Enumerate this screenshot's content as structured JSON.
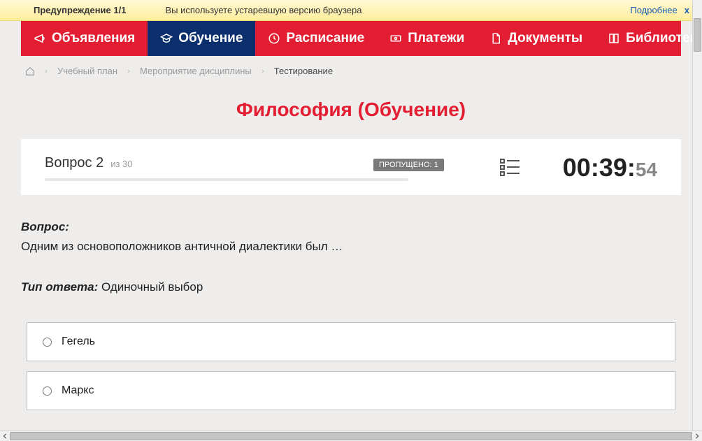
{
  "warning": {
    "title": "Предупреждение 1/1",
    "message": "Вы используете устаревшую версию браузера",
    "more": "Подробнее",
    "close": "x"
  },
  "nav": {
    "items": [
      {
        "label": "Объявления"
      },
      {
        "label": "Обучение"
      },
      {
        "label": "Расписание"
      },
      {
        "label": "Платежи"
      },
      {
        "label": "Документы"
      },
      {
        "label": "Библиотека"
      }
    ]
  },
  "breadcrumb": {
    "items": [
      "Учебный план",
      "Мероприятие дисциплины",
      "Тестирование"
    ]
  },
  "page_title": "Философия (Обучение)",
  "card": {
    "question_label": "Вопрос 2",
    "total_label": "из 30",
    "skipped": "ПРОПУЩЕНО: 1",
    "timer_main": "00:39:",
    "timer_sec": "54"
  },
  "question": {
    "heading": "Вопрос:",
    "text": "Одним из основоположников античной диалектики был …"
  },
  "answer_type": {
    "label": "Тип ответа:",
    "value": "Одиночный выбор"
  },
  "options": [
    {
      "label": "Гегель"
    },
    {
      "label": "Маркс"
    }
  ]
}
